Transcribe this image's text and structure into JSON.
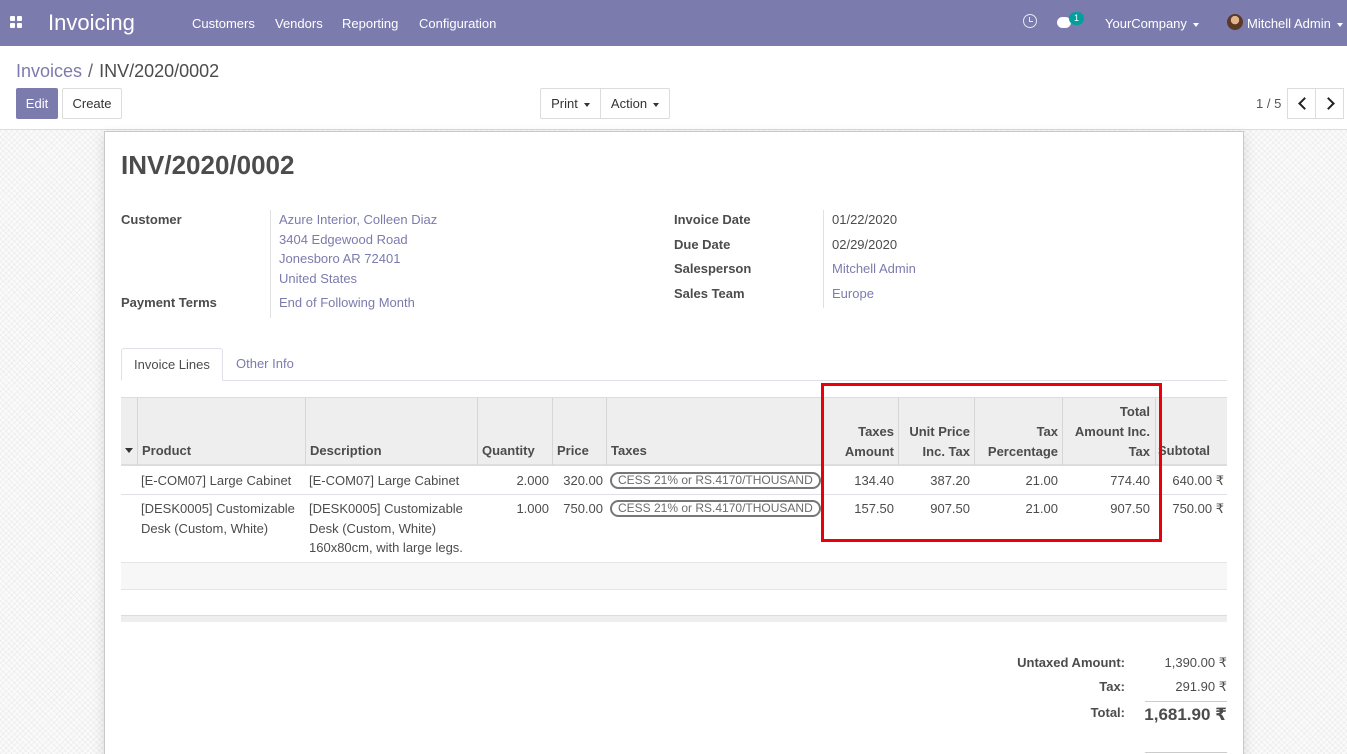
{
  "navbar": {
    "app_name": "Invoicing",
    "menu": [
      "Customers",
      "Vendors",
      "Reporting",
      "Configuration"
    ],
    "messages_badge": "1",
    "company": "YourCompany",
    "user": "Mitchell Admin",
    "icons": [
      "apps-icon",
      "clock-icon",
      "chat-icon"
    ],
    "color": "#7c7bad"
  },
  "breadcrumb": {
    "parent": "Invoices",
    "separator": "/",
    "current": "INV/2020/0002"
  },
  "buttons": {
    "edit": "Edit",
    "create": "Create",
    "print": "Print",
    "action": "Action"
  },
  "pager": {
    "value": "1 / 5"
  },
  "invoice": {
    "number": "INV/2020/0002",
    "labels": {
      "customer": "Customer",
      "payment_terms": "Payment Terms",
      "invoice_date": "Invoice Date",
      "due_date": "Due Date",
      "salesperson": "Salesperson",
      "sales_team": "Sales Team"
    },
    "customer": {
      "name": "Azure Interior, Colleen Diaz",
      "street": "3404 Edgewood Road",
      "city": "Jonesboro AR 72401",
      "country": "United States"
    },
    "payment_terms": "End of Following Month",
    "invoice_date": "01/22/2020",
    "due_date": "02/29/2020",
    "salesperson": "Mitchell Admin",
    "sales_team": "Europe"
  },
  "tabs": [
    "Invoice Lines",
    "Other Info"
  ],
  "table": {
    "headers": {
      "product": "Product",
      "description": "Description",
      "quantity": "Quantity",
      "price": "Price",
      "taxes": "Taxes",
      "taxes_amount": [
        "Taxes",
        "Amount"
      ],
      "unit_price_inc": [
        "Unit Price",
        "Inc. Tax"
      ],
      "tax_percentage": [
        "Tax",
        "Percentage"
      ],
      "total_inc": [
        "Total",
        "Amount Inc.",
        "Tax"
      ],
      "subtotal": "Subtotal"
    },
    "rows": [
      {
        "product": [
          "[E-COM07] Large Cabinet"
        ],
        "description": [
          "[E-COM07] Large Cabinet"
        ],
        "quantity": "2.000",
        "price": "320.00",
        "tax": "CESS 21% or RS.4170/THOUSAND",
        "taxes_amount": "134.40",
        "unit_price_inc": "387.20",
        "tax_percentage": "21.00",
        "total_inc": "774.40",
        "subtotal": "640.00 ₹"
      },
      {
        "product": [
          "[DESK0005] Customizable",
          "Desk (Custom, White)"
        ],
        "description": [
          "[DESK0005] Customizable",
          "Desk (Custom, White)",
          "160x80cm, with large legs."
        ],
        "quantity": "1.000",
        "price": "750.00",
        "tax": "CESS 21% or RS.4170/THOUSAND",
        "taxes_amount": "157.50",
        "unit_price_inc": "907.50",
        "tax_percentage": "21.00",
        "total_inc": "907.50",
        "subtotal": "750.00 ₹"
      }
    ]
  },
  "totals": {
    "untaxed_label": "Untaxed Amount:",
    "untaxed": "1,390.00 ₹",
    "tax_label": "Tax:",
    "tax": "291.90 ₹",
    "total_label": "Total:",
    "total": "1,681.90 ₹"
  },
  "highlight_color": "#e8000b"
}
